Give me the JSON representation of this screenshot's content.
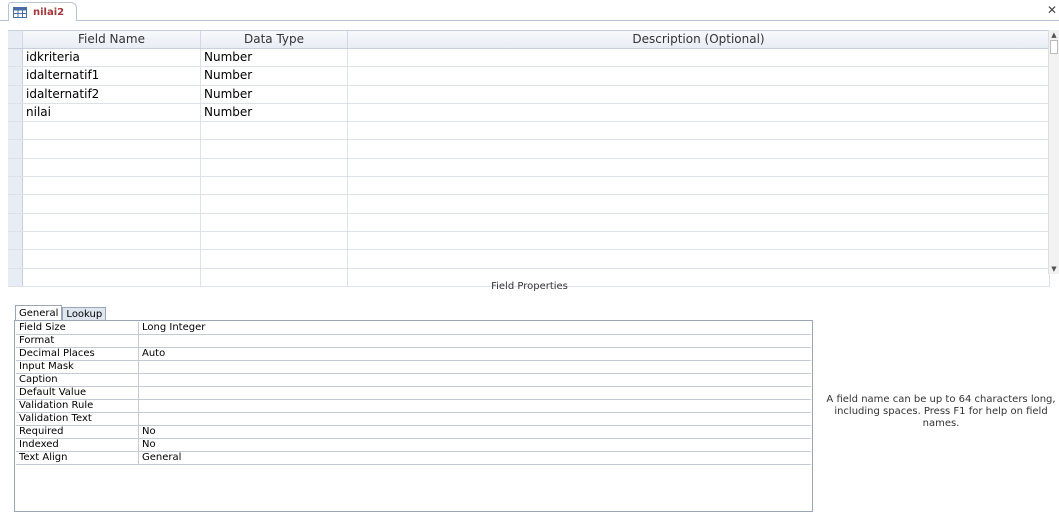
{
  "tab": {
    "title": "nilai2",
    "icon": "table-icon"
  },
  "grid": {
    "headers": {
      "field_name": "Field Name",
      "data_type": "Data Type",
      "description": "Description (Optional)"
    },
    "rows": [
      {
        "name": "idkriteria",
        "type": "Number",
        "desc": ""
      },
      {
        "name": "idalternatif1",
        "type": "Number",
        "desc": ""
      },
      {
        "name": "idalternatif2",
        "type": "Number",
        "desc": ""
      },
      {
        "name": "nilai",
        "type": "Number",
        "desc": ""
      },
      {
        "name": "",
        "type": "",
        "desc": ""
      },
      {
        "name": "",
        "type": "",
        "desc": ""
      },
      {
        "name": "",
        "type": "",
        "desc": ""
      },
      {
        "name": "",
        "type": "",
        "desc": ""
      },
      {
        "name": "",
        "type": "",
        "desc": ""
      },
      {
        "name": "",
        "type": "",
        "desc": ""
      },
      {
        "name": "",
        "type": "",
        "desc": ""
      },
      {
        "name": "",
        "type": "",
        "desc": ""
      },
      {
        "name": "",
        "type": "",
        "desc": ""
      }
    ]
  },
  "field_properties": {
    "title": "Field Properties",
    "tabs": [
      "General",
      "Lookup"
    ],
    "rows": [
      {
        "label": "Field Size",
        "value": "Long Integer"
      },
      {
        "label": "Format",
        "value": ""
      },
      {
        "label": "Decimal Places",
        "value": "Auto"
      },
      {
        "label": "Input Mask",
        "value": ""
      },
      {
        "label": "Caption",
        "value": ""
      },
      {
        "label": "Default Value",
        "value": ""
      },
      {
        "label": "Validation Rule",
        "value": ""
      },
      {
        "label": "Validation Text",
        "value": ""
      },
      {
        "label": "Required",
        "value": "No"
      },
      {
        "label": "Indexed",
        "value": "No"
      },
      {
        "label": "Text Align",
        "value": "General"
      }
    ],
    "help_text": "A field name can be up to 64 characters long, including spaces. Press F1 for help on field names."
  },
  "colors": {
    "tab_title": "#a4373a",
    "header_bg": "#e8edf5"
  }
}
